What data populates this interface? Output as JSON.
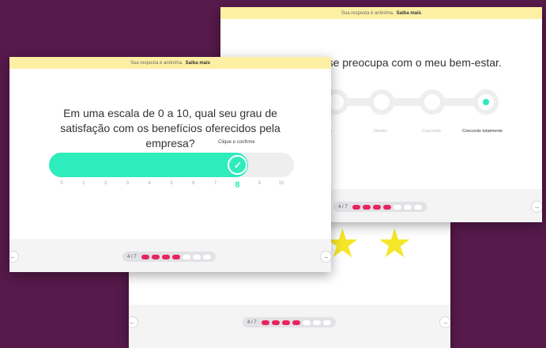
{
  "banner": {
    "text": "Sua resposta é anônima.",
    "link": "Saiba mais"
  },
  "back_card": {
    "question_fragment": "to se preocupa com o meu bem-estar.",
    "scale_labels": [
      "ordo",
      "Neutro",
      "Concordo",
      "Concordo totalmente"
    ],
    "selected_label": "Concordo totalmente",
    "pager": {
      "text": "4 / 7",
      "total": 7,
      "done": 4
    }
  },
  "bottom_card": {
    "stars": [
      "★",
      "★"
    ],
    "pager": {
      "text": "4 / 7",
      "total": 7,
      "done": 4
    }
  },
  "front_card": {
    "question": "Em uma escala de 0 a 10, qual seu grau de satisfação com os benefícios oferecidos pela empresa?",
    "hint": "Clique e confirme",
    "slider": {
      "min": 0,
      "max": 10,
      "value": 8
    },
    "tick_labels": [
      "0",
      "1",
      "2",
      "3",
      "4",
      "5",
      "6",
      "7",
      "8",
      "9",
      "10"
    ],
    "pager": {
      "text": "4 / 7",
      "total": 7,
      "done": 4
    }
  },
  "icons": {
    "back": "arrow-left-icon",
    "next": "arrow-right-icon",
    "confirm": "check-icon",
    "rating": "star-icon"
  },
  "colors": {
    "background": "#561a4b",
    "banner": "#fdf0a4",
    "accent": "#2eecbb",
    "progress": "#e8245e",
    "star": "#f5e62a"
  }
}
